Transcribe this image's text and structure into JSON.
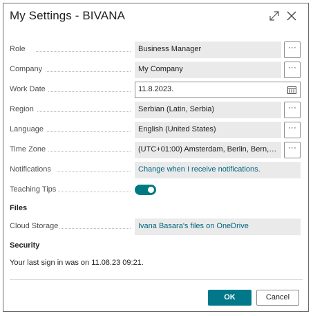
{
  "dialog": {
    "title": "My Settings - BIVANA"
  },
  "fields": {
    "role": {
      "label": "Role",
      "value": "Business Manager",
      "assist": "···"
    },
    "company": {
      "label": "Company",
      "value": "My Company",
      "assist": "···"
    },
    "work_date": {
      "label": "Work Date",
      "value": "11.8.2023."
    },
    "region": {
      "label": "Region",
      "value": "Serbian (Latin, Serbia)",
      "assist": "···"
    },
    "language": {
      "label": "Language",
      "value": "English (United States)",
      "assist": "···"
    },
    "time_zone": {
      "label": "Time Zone",
      "value": "(UTC+01:00) Amsterdam, Berlin, Bern, Ro...",
      "assist": "···"
    },
    "notifications": {
      "label": "Notifications",
      "value": "Change when I receive notifications."
    },
    "teaching_tips": {
      "label": "Teaching Tips",
      "enabled": true
    }
  },
  "files": {
    "heading": "Files",
    "cloud_storage": {
      "label": "Cloud Storage",
      "value": "Ivana Basara's files on OneDrive"
    }
  },
  "security": {
    "heading": "Security",
    "last_sign_in": "Your last sign in was on 11.08.23 09:21."
  },
  "buttons": {
    "ok": "OK",
    "cancel": "Cancel"
  },
  "colors": {
    "accent": "#00788a",
    "link": "#00677f",
    "field_bg": "#eaeaea"
  }
}
